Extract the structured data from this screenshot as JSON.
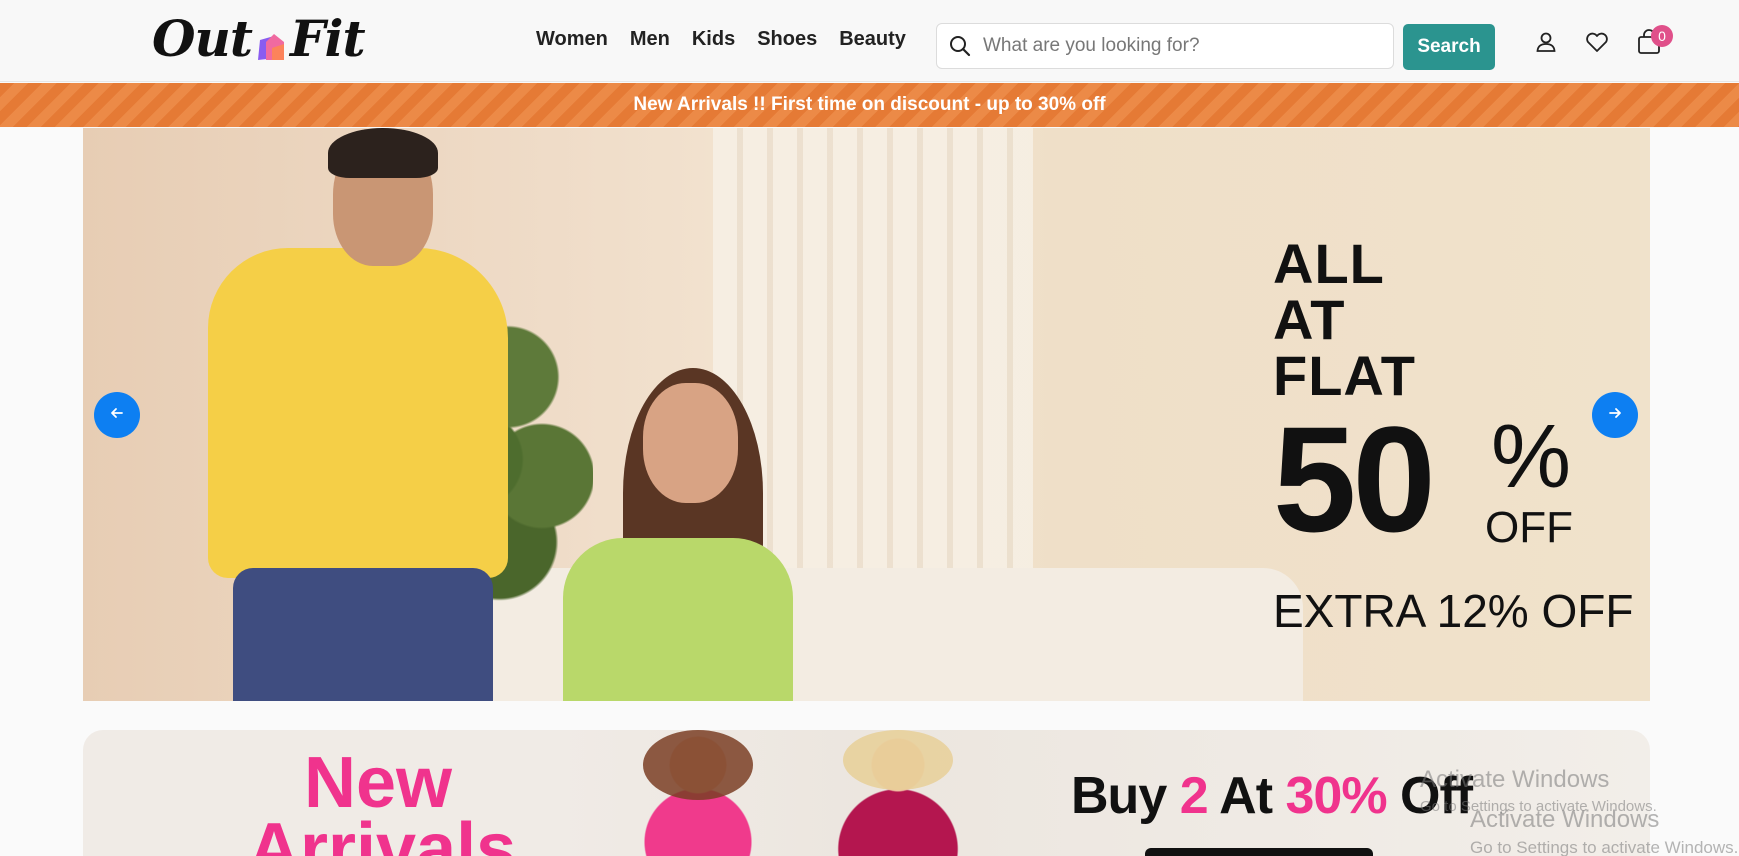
{
  "header": {
    "logo": {
      "left": "Out",
      "right": "Fit"
    },
    "nav": [
      "Women",
      "Men",
      "Kids",
      "Shoes",
      "Beauty"
    ],
    "search": {
      "placeholder": "What are you looking for?",
      "button_label": "Search"
    },
    "cart_count": "0",
    "icons": [
      "search-icon",
      "user-icon",
      "heart-icon",
      "cart-icon"
    ]
  },
  "promo": {
    "text": "New Arrivals !! First time on discount - up to 30% off"
  },
  "hero": {
    "line1": "ALL",
    "line2": "AT",
    "line3": "FLAT",
    "big_number": "50",
    "percent": "%",
    "off": "OFF",
    "extra": "EXTRA 12% OFF",
    "prev_icon": "arrow-left-icon",
    "next_icon": "arrow-right-icon"
  },
  "banner2": {
    "new_arrivals": "New Arrivals",
    "buy_a": "Buy",
    "buy_b": "2",
    "buy_c": "At",
    "buy_d": "30%",
    "buy_e": "Off"
  },
  "watermark": {
    "title": "Activate Windows",
    "subtitle": "Go to Settings to activate Windows."
  },
  "colors": {
    "accent_teal": "#2b948f",
    "promo_orange": "#e57a35",
    "brand_pink": "#f0338d",
    "carousel_blue": "#0d7ff2",
    "cart_badge": "#e0508a"
  }
}
